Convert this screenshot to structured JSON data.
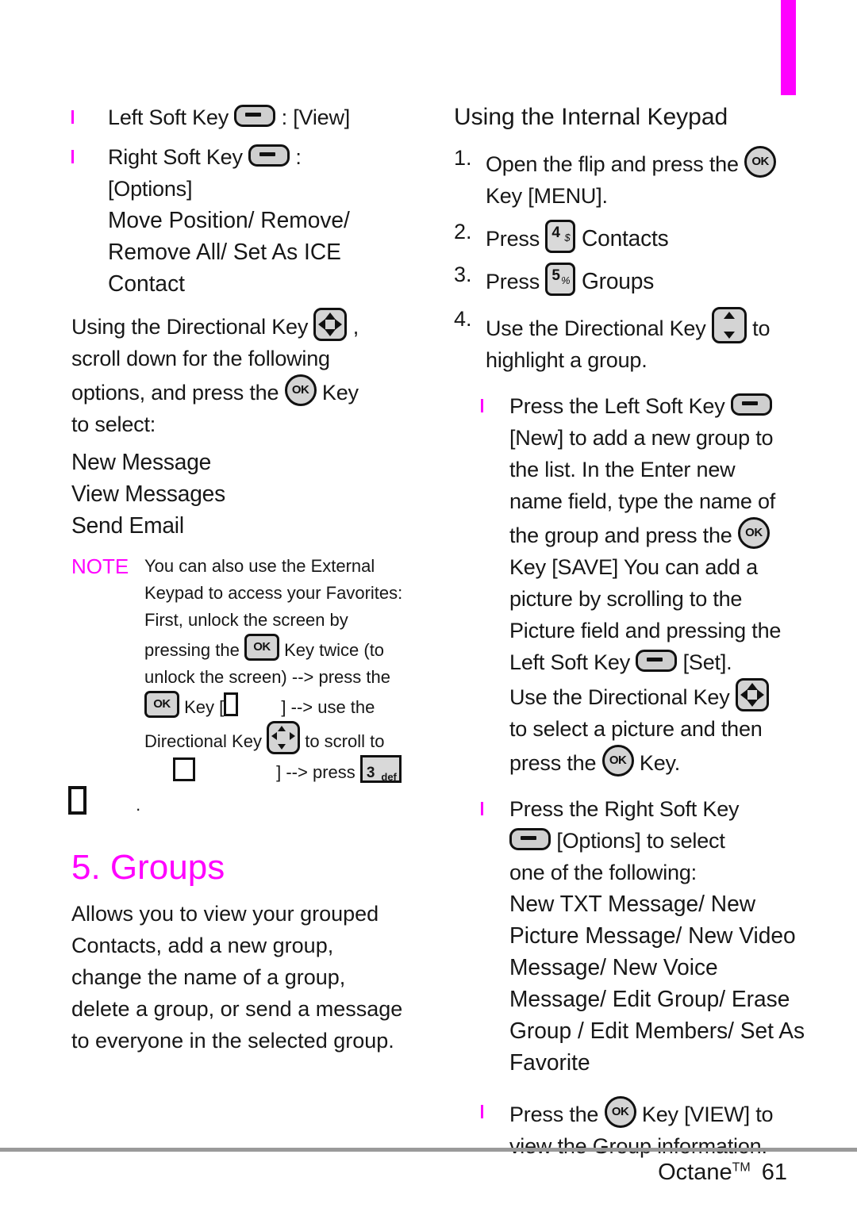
{
  "theme": {
    "accent": "#ff00ff",
    "key_fill": "#d4d4d4",
    "rule": "#9a9a9a"
  },
  "left_column": {
    "soft_keys": [
      {
        "label": "Left Soft Key",
        "icon": "soft-key-pill-icon",
        "sep": ":",
        "value": "[View]"
      },
      {
        "label": "Right Soft Key",
        "icon": "soft-key-pill-icon",
        "sep": ":",
        "value": "[Options]"
      }
    ],
    "options_list": "Move Position/ Remove/ Remove All/ Set As ICE Contact",
    "directional_intro": {
      "before": "Using the Directional Key",
      "icon": "directional-key-icon",
      "after_icon": ",",
      "line2": "scroll down for the following",
      "line3_before": "options, and press the",
      "line3_icon": "ok-key-icon",
      "line3_after": "Key",
      "line4": "to select:"
    },
    "menu_items": [
      "New Message",
      "View Messages",
      "Send Email"
    ],
    "note": {
      "label": "NOTE",
      "line1": "You can also use the External",
      "line2": "Keypad to access your Favorites:",
      "line3": "First, unlock the screen by",
      "line4_before": "pressing the",
      "line4_icon": "ok-key-square-icon",
      "line4_after": "Key twice (to",
      "line5": "unlock the screen) --> press the",
      "line6_icon": "ok-key-square-icon",
      "line6_before": "Key [",
      "line6_missing": "missing-glyph",
      "line6_after": "] --> use the",
      "line7_before": "Directional Key",
      "line7_icon": "directional-key-chevron-icon",
      "line7_after": "to scroll to",
      "line8_missing": "missing-glyph",
      "line8_mid": "] --> press",
      "line8_icon": "key-3-def-icon",
      "line9_missing": "missing-glyph",
      "line9_after": "."
    },
    "section": {
      "heading": "5. Groups",
      "body": "Allows you to view your grouped Contacts, add a new group, change the name of a group, delete a group, or send a message to everyone in the selected group."
    }
  },
  "right_column": {
    "heading": "Using the Internal Keypad",
    "steps": [
      {
        "num": "1.",
        "before": "Open the flip and press the",
        "icon": "ok-key-icon",
        "line2": "Key [MENU]."
      },
      {
        "num": "2.",
        "before": "Press",
        "icon": "key-4-icon",
        "key_digit": "4",
        "key_sup": "$",
        "after": "Contacts"
      },
      {
        "num": "3.",
        "before": "Press",
        "icon": "key-5-icon",
        "key_digit": "5",
        "key_sup": "%",
        "after": "Groups"
      },
      {
        "num": "4.",
        "before": "Use the Directional Key",
        "icon": "directional-key-updown-icon",
        "after": "to",
        "line2": "highlight a group."
      }
    ],
    "bullets": [
      {
        "name": "new-group-bullet",
        "l1_before": "Press the Left Soft Key",
        "l1_icon": "soft-key-pill-icon",
        "l2": "[New] to add a new group to",
        "l3": "the list. In the Enter new",
        "l4": "name field, type the name of",
        "l5_before": "the group and press the",
        "l5_icon": "ok-key-icon",
        "l6": "Key [SAVE] You can add a",
        "l7": "picture by scrolling to the",
        "l8": "Picture field and pressing the",
        "l9_before": "Left Soft Key",
        "l9_icon": "soft-key-pill-icon",
        "l9_after": "[Set].",
        "l10_before": "Use the Directional Key",
        "l10_icon": "directional-key-icon",
        "l11": "to select a picture and then",
        "l12_before": "press the",
        "l12_icon": "ok-key-icon",
        "l12_after": "Key."
      },
      {
        "name": "options-bullet",
        "l1": "Press the Right Soft Key",
        "l2_icon": "soft-key-pill-icon",
        "l2_after": "[Options] to select",
        "l3": "one of the following:",
        "options": "New TXT Message/ New Picture Message/ New Video Message/ New Voice Message/ Edit Group/ Erase Group / Edit Members/ Set As Favorite"
      },
      {
        "name": "view-bullet",
        "l1_before": "Press the",
        "l1_icon": "ok-key-icon",
        "l1_after": "Key [VIEW] to",
        "l2": "view the Group information."
      }
    ]
  },
  "footer": {
    "product": "Octane",
    "tm": "TM",
    "page": "61"
  }
}
